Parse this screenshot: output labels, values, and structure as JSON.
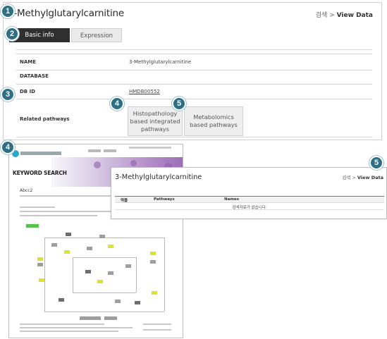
{
  "page": {
    "title": "3-Methylglutarylcarnitine",
    "breadcrumb_search": "검색",
    "breadcrumb_sep": ">",
    "breadcrumb_current": "View Data"
  },
  "tabs": [
    "Basic info",
    "Expression"
  ],
  "info_rows": [
    {
      "label": "NAME",
      "value": "3-Methylglutarylcarnitine"
    },
    {
      "label": "DATABASE",
      "value": ""
    },
    {
      "label": "DB ID",
      "value": "HMDB00552"
    },
    {
      "label": "Related pathways",
      "value": ""
    }
  ],
  "pathway_buttons": [
    "Histopathology based integrated pathways",
    "Metabolomics based pathways"
  ],
  "badges": [
    "1",
    "2",
    "3",
    "4",
    "5",
    "4",
    "5"
  ],
  "screenshot_left": {
    "heading": "KEYWORD SEARCH",
    "name": "Abcc2"
  },
  "screenshot_right": {
    "title": "3-Methylglutarylcarnitine",
    "breadcrumb_search": "검색",
    "breadcrumb_sep": ">",
    "breadcrumb_current": "View Data",
    "columns": [
      "약물",
      "Pathways",
      "Names"
    ],
    "empty_message": "검색자료가 없습니다."
  },
  "colors": {
    "badge": "#2c6f86",
    "active_tab": "#2f2f2f",
    "inactive_tab": "#eaeaea",
    "pathway_button": "#eeeeee"
  }
}
